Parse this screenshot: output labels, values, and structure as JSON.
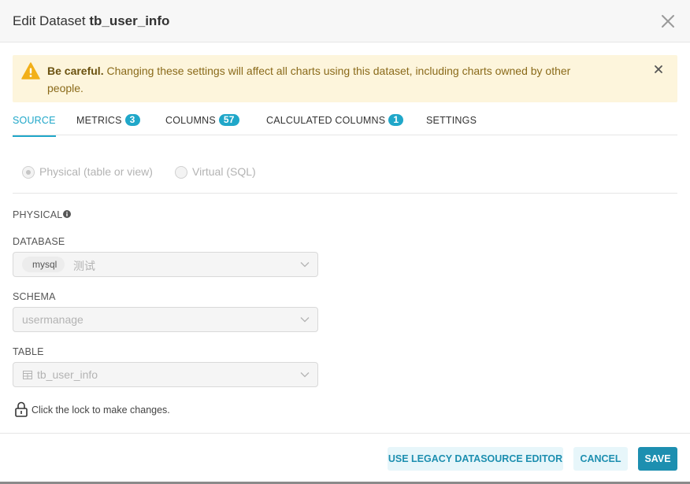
{
  "header": {
    "title_prefix": "Edit Dataset",
    "dataset_name": "tb_user_info"
  },
  "alert": {
    "strong": "Be careful.",
    "message": "Changing these settings will affect all charts using this dataset, including charts owned by other people."
  },
  "tabs": [
    {
      "label": "SOURCE",
      "badge": null,
      "active": true
    },
    {
      "label": "METRICS",
      "badge": "3",
      "active": false
    },
    {
      "label": "COLUMNS",
      "badge": "57",
      "active": false
    },
    {
      "label": "CALCULATED COLUMNS",
      "badge": "1",
      "active": false
    },
    {
      "label": "SETTINGS",
      "badge": null,
      "active": false
    }
  ],
  "source_type": {
    "options": [
      {
        "label": "Physical (table or view)",
        "checked": true
      },
      {
        "label": "Virtual (SQL)",
        "checked": false
      }
    ]
  },
  "physical": {
    "section_label": "PHYSICAL",
    "database_label": "DATABASE",
    "database_backend": "mysql",
    "database_name": "测试",
    "schema_label": "SCHEMA",
    "schema_value": "usermanage",
    "table_label": "TABLE",
    "table_value": "tb_user_info",
    "lock_text": "Click the lock to make changes."
  },
  "footer": {
    "legacy_label": "USE LEGACY DATASOURCE EDITOR",
    "cancel_label": "CANCEL",
    "save_label": "SAVE"
  },
  "colors": {
    "accent": "#20a7c9",
    "primary_button": "#1d8fb0",
    "warning_bg": "#fdf5dc",
    "warning_icon": "#f2b019"
  }
}
